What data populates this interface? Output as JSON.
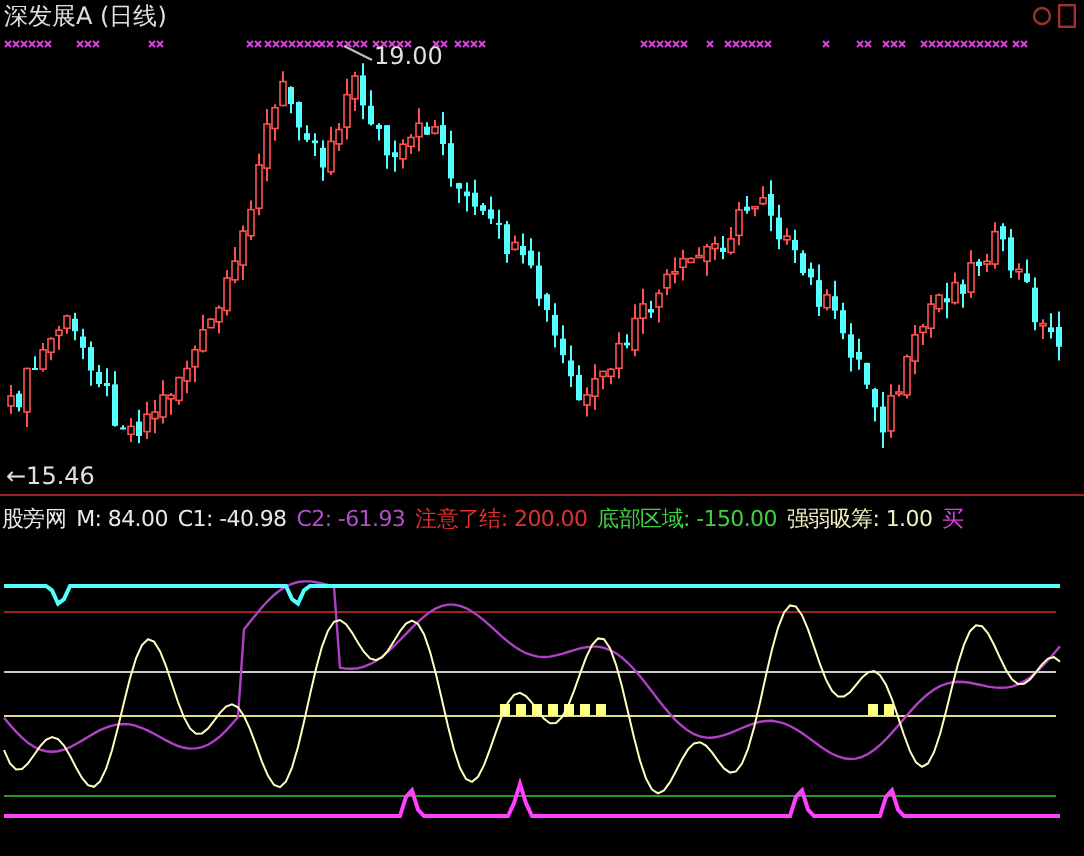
{
  "window": {
    "title": "深发展A (日线)"
  },
  "price_chart": {
    "high_label": "19.00",
    "low_label": "←15.46"
  },
  "indicator": {
    "name": "股旁网",
    "values": [
      {
        "label": "M: 84.00",
        "color": "#e8e8e8"
      },
      {
        "label": "C1: -40.98",
        "color": "#e8e8e8"
      },
      {
        "label": "C2: -61.93",
        "color": "#b050c8"
      },
      {
        "label": "注意了结: 200.00",
        "color": "#e03030"
      },
      {
        "label": "底部区域: -150.00",
        "color": "#40d040"
      },
      {
        "label": "强弱吸筹: 1.00",
        "color": "#f0f0c0"
      },
      {
        "label": "买",
        "color": "#e040e0"
      }
    ]
  }
}
